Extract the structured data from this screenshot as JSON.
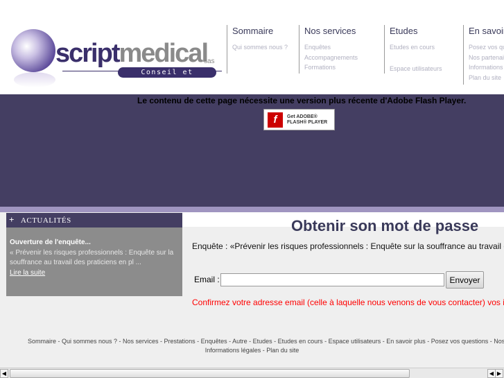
{
  "logo": {
    "brand_dark": "script",
    "brand_light": "medical",
    "suffix": "sas",
    "tagline": "Conseil et Formation"
  },
  "nav": [
    {
      "title": "Sommaire",
      "links": [
        "Qui sommes nous ?"
      ]
    },
    {
      "title": "Nos services",
      "links": [
        "Enquêtes",
        "Accompagnements",
        "Formations"
      ]
    },
    {
      "title": "Etudes",
      "links": [
        "Etudes en cours",
        "",
        "Espace utilisateurs"
      ]
    },
    {
      "title": "En savoir plus",
      "links": [
        "Posez vos questions",
        "Nos partenaires",
        "Informations légales",
        "Plan du site"
      ]
    }
  ],
  "flash": {
    "message": "Le contenu de cette page nécessite une version plus récente d'Adobe Flash Player.",
    "button_line1": "Get ADOBE®",
    "button_line2": "FLASH® PLAYER"
  },
  "sidebar": {
    "title": "ACTUALITÉS",
    "news_title": "Ouverture de l'enquête...",
    "news_text": "« Prévenir les risques professionnels : Enquête sur la souffrance au travail des praticiens en pl ...",
    "read_more": "Lire la suite"
  },
  "main": {
    "title": "Obtenir son mot de passe",
    "intro": "Enquête : «Prévenir les risques professionnels : Enquête sur la souffrance au travail des praticiens en plateau technique lourd»",
    "email_label": "Email :",
    "email_value": "",
    "submit": "Envoyer",
    "confirm": "Confirmez votre adresse email (celle à laquelle nous venons de vous contacter) vos identifiants pour accéder au questionnaire vous y seront envoyés"
  },
  "footer": {
    "line1": "Sommaire - Qui sommes nous ? - Nos services - Prestations - Enquêtes - Autre - Etudes - Etudes en cours - Espace utilisateurs - En savoir plus - Posez vos questions - Nos partenaires -",
    "line2": "Informations légales - Plan du site"
  }
}
